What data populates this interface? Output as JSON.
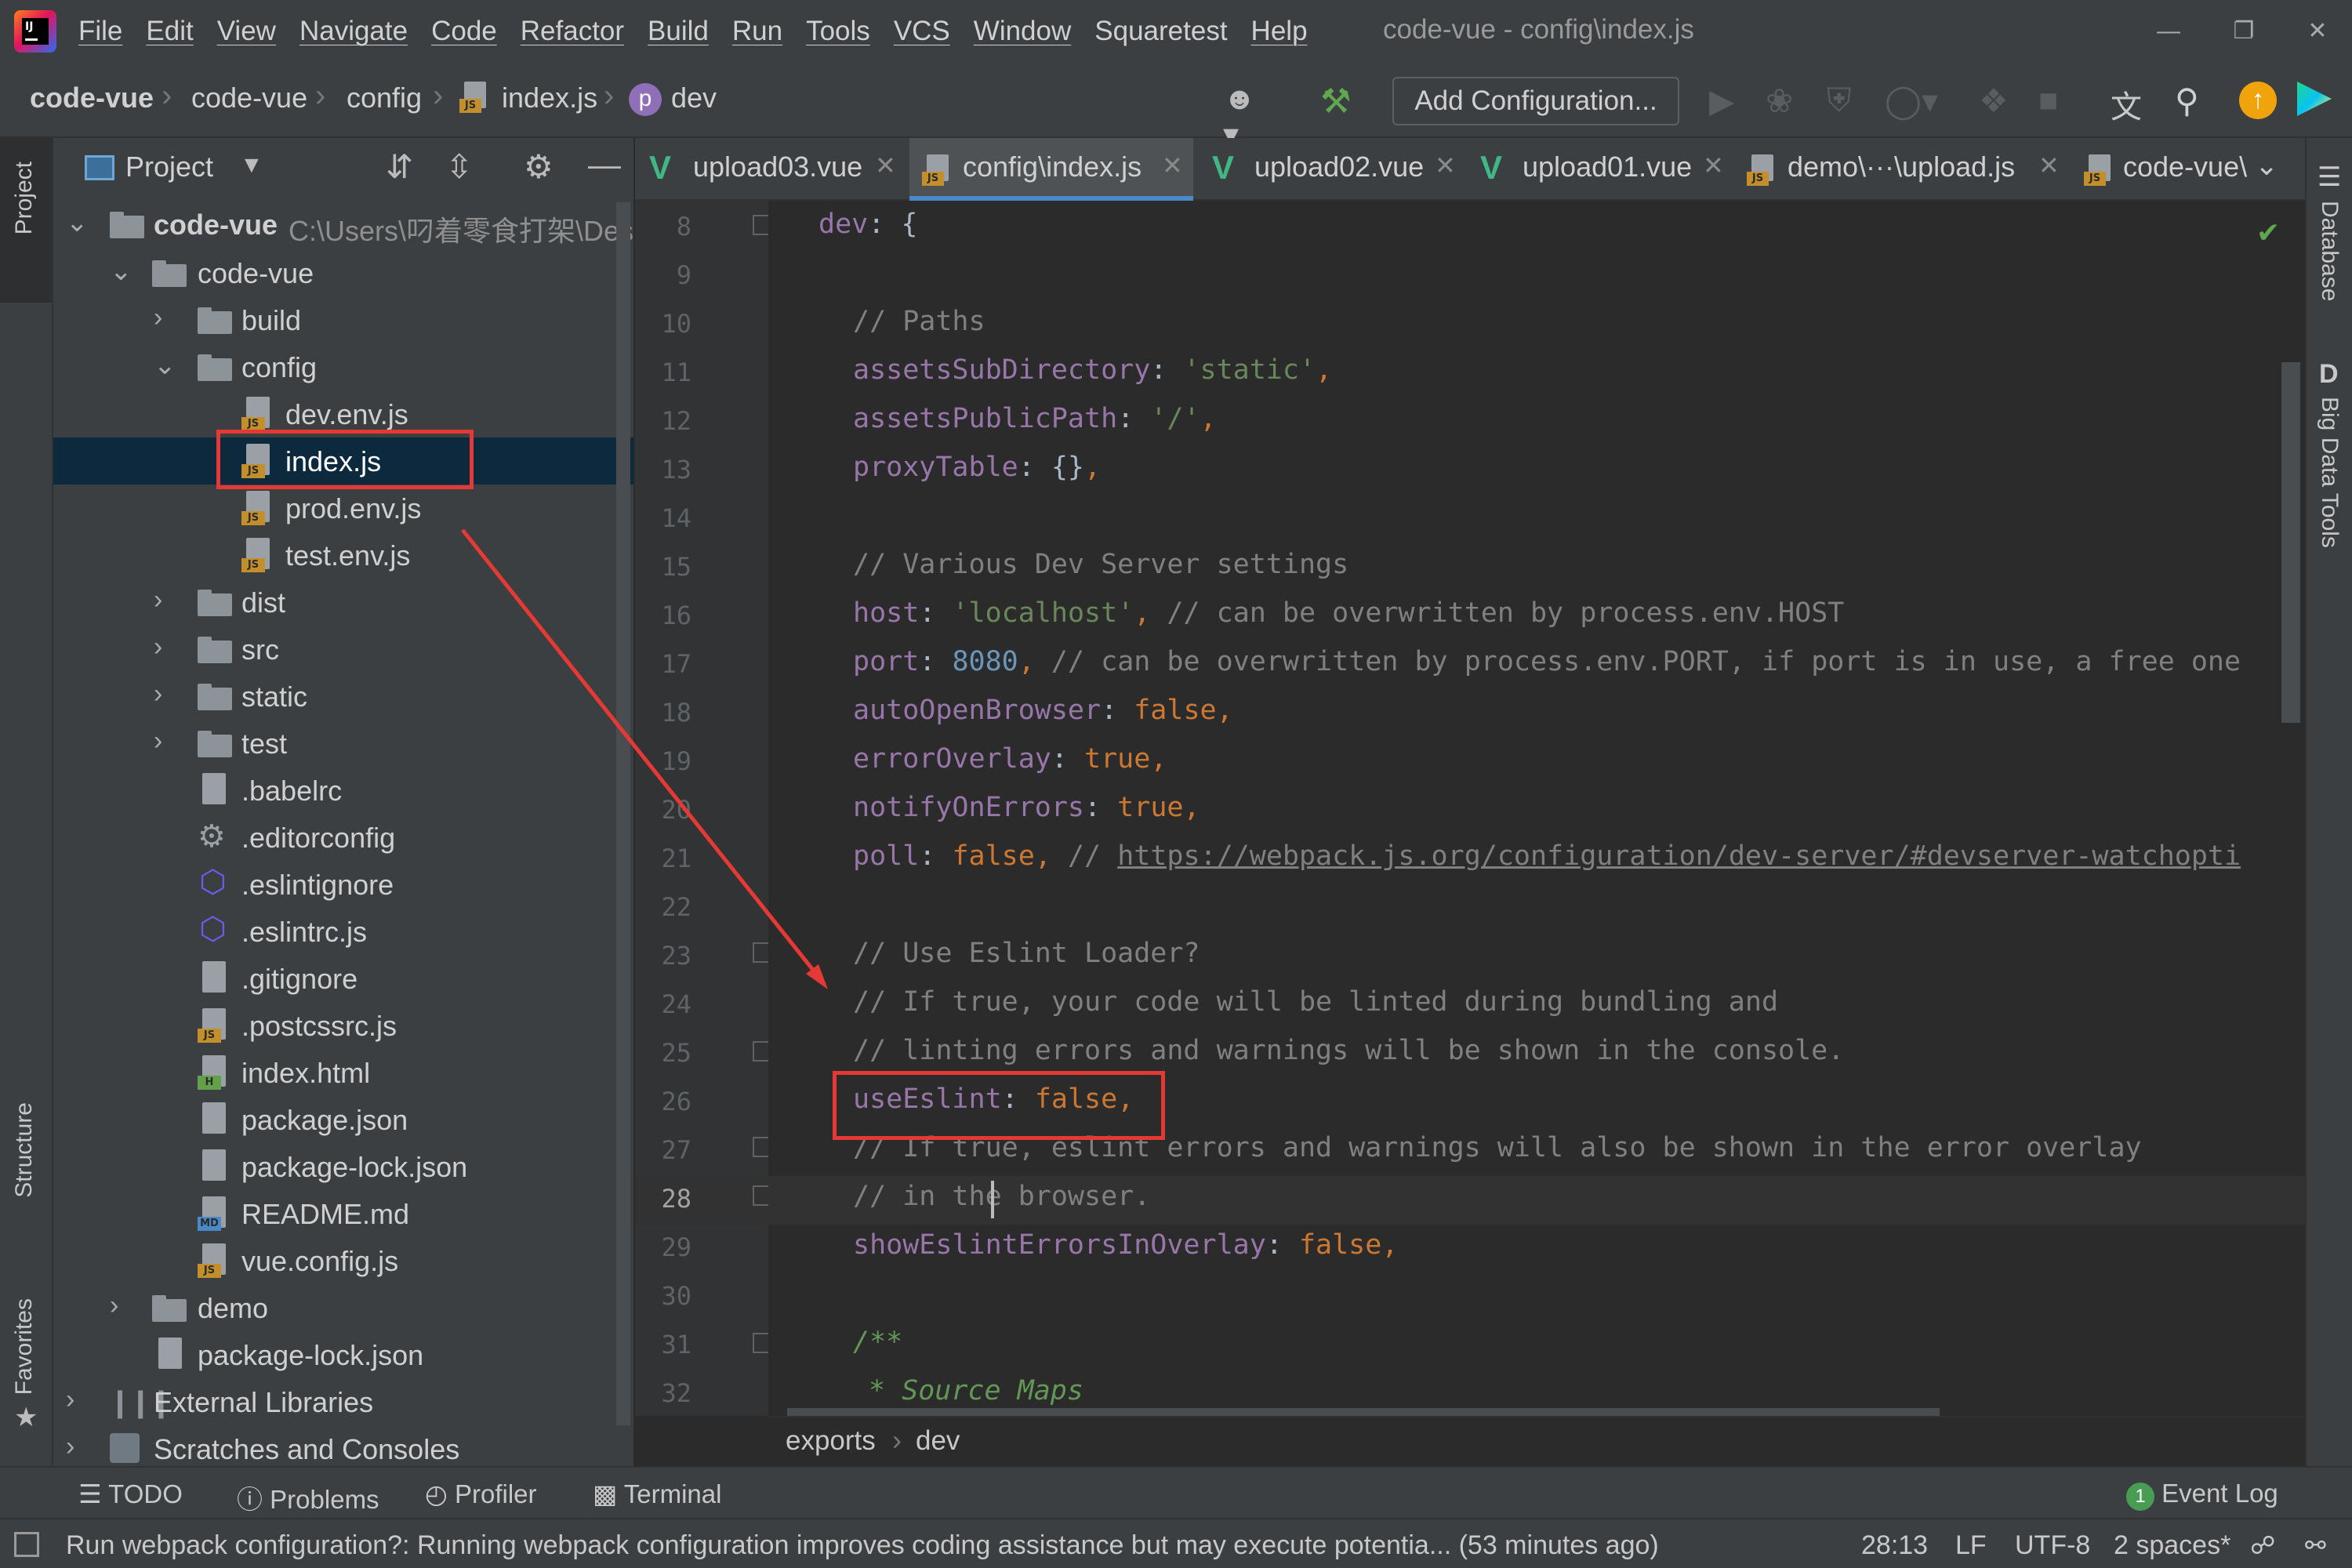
{
  "app": {
    "logo_text": "IJ",
    "window_title": "code-vue - config\\index.js"
  },
  "menu": [
    "File",
    "Edit",
    "View",
    "Navigate",
    "Code",
    "Refactor",
    "Build",
    "Run",
    "Tools",
    "VCS",
    "Window",
    "Squaretest",
    "Help"
  ],
  "navbar": {
    "crumbs": [
      "code-vue",
      "code-vue",
      "config",
      "index.js",
      "dev"
    ],
    "dev_badge": "p",
    "add_configuration": "Add Configuration..."
  },
  "left_strip": {
    "project_tab": "Project",
    "structure_tab": "Structure",
    "favorites_tab": "Favorites"
  },
  "right_strip": {
    "database_tab": "Database",
    "bigdata_tab": "Big Data Tools",
    "bigdata_glyph": "D"
  },
  "project_panel": {
    "title": "Project",
    "root_name": "code-vue",
    "root_path": "C:\\Users\\叼着零食打架\\Desk",
    "tree": [
      {
        "label": "code-vue",
        "kind": "folder",
        "expanded": true
      },
      {
        "label": "build",
        "kind": "folder",
        "expanded": false
      },
      {
        "label": "config",
        "kind": "folder",
        "expanded": true
      },
      {
        "label": "dev.env.js",
        "kind": "js"
      },
      {
        "label": "index.js",
        "kind": "js",
        "selected": true
      },
      {
        "label": "prod.env.js",
        "kind": "js"
      },
      {
        "label": "test.env.js",
        "kind": "js"
      },
      {
        "label": "dist",
        "kind": "folder",
        "expanded": false
      },
      {
        "label": "src",
        "kind": "folder",
        "expanded": false
      },
      {
        "label": "static",
        "kind": "folder",
        "expanded": false
      },
      {
        "label": "test",
        "kind": "folder",
        "expanded": false
      },
      {
        "label": ".babelrc",
        "kind": "config"
      },
      {
        "label": ".editorconfig",
        "kind": "gear"
      },
      {
        "label": ".eslintignore",
        "kind": "eslint"
      },
      {
        "label": ".eslintrc.js",
        "kind": "eslint"
      },
      {
        "label": ".gitignore",
        "kind": "config"
      },
      {
        "label": ".postcssrc.js",
        "kind": "js"
      },
      {
        "label": "index.html",
        "kind": "html"
      },
      {
        "label": "package.json",
        "kind": "config"
      },
      {
        "label": "package-lock.json",
        "kind": "config"
      },
      {
        "label": "README.md",
        "kind": "md"
      },
      {
        "label": "vue.config.js",
        "kind": "js"
      },
      {
        "label": "demo",
        "kind": "folder",
        "expanded": false
      },
      {
        "label": "package-lock.json",
        "kind": "config"
      },
      {
        "label": "External Libraries",
        "kind": "lib"
      },
      {
        "label": "Scratches and Consoles",
        "kind": "scratch"
      }
    ]
  },
  "tabs": [
    {
      "label": "upload03.vue",
      "kind": "vue"
    },
    {
      "label": "config\\index.js",
      "kind": "js",
      "active": true
    },
    {
      "label": "upload02.vue",
      "kind": "vue"
    },
    {
      "label": "upload01.vue",
      "kind": "vue"
    },
    {
      "label": "demo\\···\\upload.js",
      "kind": "js"
    },
    {
      "label": "code-vue\\",
      "kind": "js"
    }
  ],
  "editor": {
    "line_numbers": [
      "8",
      "9",
      "10",
      "11",
      "12",
      "13",
      "14",
      "15",
      "16",
      "17",
      "18",
      "19",
      "20",
      "21",
      "22",
      "23",
      "24",
      "25",
      "26",
      "27",
      "28",
      "29",
      "30",
      "31",
      "32"
    ],
    "current_line": "28",
    "breadcrumb": [
      "exports",
      "dev"
    ],
    "code": {
      "l8": [
        "dev",
        ": {"
      ],
      "l10": "// Paths",
      "l11": [
        "assetsSubDirectory",
        ": ",
        "'static'",
        ","
      ],
      "l12": [
        "assetsPublicPath",
        ": ",
        "'/'",
        ","
      ],
      "l13": [
        "proxyTable",
        ": {}",
        ","
      ],
      "l15": "// Various Dev Server settings",
      "l16": [
        "host",
        ": ",
        "'localhost'",
        ", ",
        "// can be overwritten by process.env.HOST"
      ],
      "l17": [
        "port",
        ": ",
        "8080",
        ", ",
        "// can be overwritten by process.env.PORT, if port is in use, a free one"
      ],
      "l18": [
        "autoOpenBrowser",
        ": ",
        "false",
        ","
      ],
      "l19": [
        "errorOverlay",
        ": ",
        "true",
        ","
      ],
      "l20": [
        "notifyOnErrors",
        ": ",
        "true",
        ","
      ],
      "l21": [
        "poll",
        ": ",
        "false",
        ", ",
        "// ",
        "https://webpack.js.org/configuration/dev-server/#devserver-watchopti"
      ],
      "l23": "// Use Eslint Loader?",
      "l24": "// If true, your code will be linted during bundling and",
      "l25": "// linting errors and warnings will be shown in the console.",
      "l26": [
        "useEslint",
        ": ",
        "false",
        ","
      ],
      "l27": "// If true, eslint errors and warnings will also be shown in the error overlay",
      "l28": "// in the browser.",
      "l29": [
        "showEslintErrorsInOverlay",
        ": ",
        "false",
        ","
      ],
      "l31": "/**",
      "l32": "* Source Maps"
    }
  },
  "toolwindows": [
    "TODO",
    "Problems",
    "Profiler",
    "Terminal"
  ],
  "event_log": {
    "count": "1",
    "label": "Event Log"
  },
  "status": {
    "message": "Run webpack configuration?: Running webpack configuration improves coding assistance but may execute potentia... (53 minutes ago)",
    "position": "28:13",
    "line_sep": "LF",
    "encoding": "UTF-8",
    "indent": "2 spaces*"
  },
  "colors": {
    "accent": "#4a88c7",
    "annotation": "#e53935",
    "selection": "#0d293e"
  }
}
